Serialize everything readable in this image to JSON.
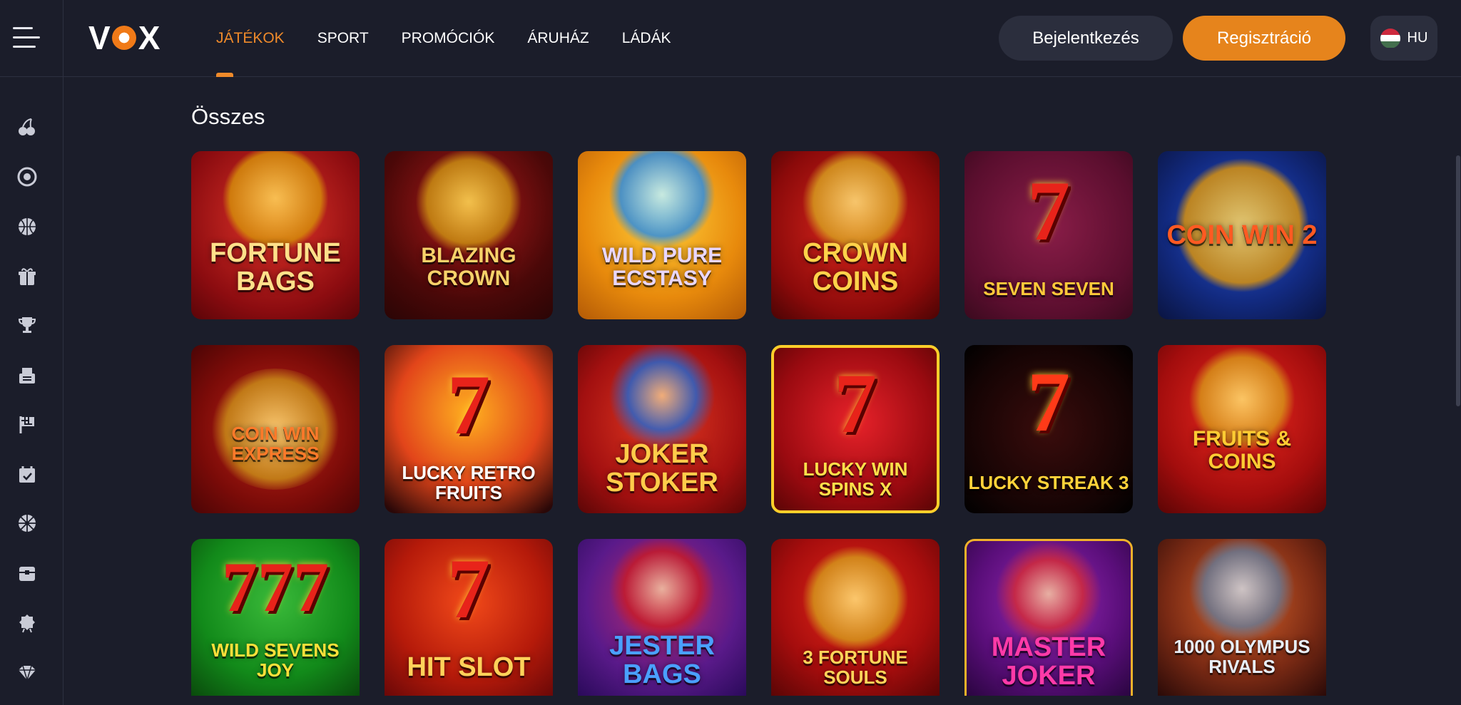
{
  "header": {
    "logo_text": "VOX",
    "nav": [
      {
        "label": "JÁTÉKOK",
        "active": true
      },
      {
        "label": "SPORT",
        "active": false
      },
      {
        "label": "PROMÓCIÓK",
        "active": false
      },
      {
        "label": "ÁRUHÁZ",
        "active": false
      },
      {
        "label": "LÁDÁK",
        "active": false
      }
    ],
    "login_label": "Bejelentkezés",
    "register_label": "Regisztráció",
    "language_code": "HU",
    "accent_color": "#e6841c"
  },
  "sidebar": {
    "icons": [
      "cherries-icon",
      "roulette-icon",
      "basketball-icon",
      "gift-icon",
      "trophy-icon",
      "tournament-icon",
      "race-flag-icon",
      "calendar-icon",
      "wheel-icon",
      "loot-box-icon",
      "badge-icon",
      "diamond-icon"
    ]
  },
  "main": {
    "section_title": "Összes",
    "games": [
      {
        "name": "FORTUNE BAGS"
      },
      {
        "name": "BLAZING CROWN"
      },
      {
        "name": "WILD PURE ECSTASY"
      },
      {
        "name": "CROWN COINS"
      },
      {
        "name": "SEVEN SEVEN"
      },
      {
        "name": "COIN WIN 2"
      },
      {
        "name": "COIN WIN EXPRESS"
      },
      {
        "name": "LUCKY RETRO FRUITS"
      },
      {
        "name": "JOKER STOKER"
      },
      {
        "name": "LUCKY WIN SPINS X"
      },
      {
        "name": "LUCKY STREAK 3"
      },
      {
        "name": "FRUITS & COINS"
      },
      {
        "name": "WILD SEVENS JOY"
      },
      {
        "name": "HIT SLOT"
      },
      {
        "name": "JESTER BAGS"
      },
      {
        "name": "3 FORTUNE SOULS"
      },
      {
        "name": "MASTER JOKER"
      },
      {
        "name": "1000 OLYMPUS RIVALS"
      }
    ]
  }
}
